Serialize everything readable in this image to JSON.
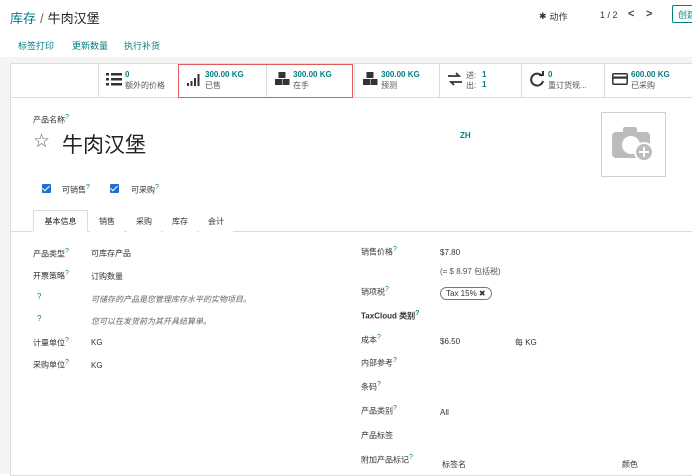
{
  "breadcrumb": {
    "parent": "库存",
    "separator": "/",
    "current": "牛肉汉堡"
  },
  "header": {
    "actions_label": "动作",
    "pager": "1 / 2",
    "create_label": "创建"
  },
  "toolbar": {
    "print_labels": "标签打印",
    "update_qty": "更新数量",
    "replenish": "执行补货"
  },
  "stats": [
    {
      "icon": "list-icon",
      "value": "0",
      "label": "额外的价格"
    },
    {
      "icon": "bar-chart-icon",
      "value": "300.00 KG",
      "label": "已售"
    },
    {
      "icon": "cubes-icon",
      "value": "300.00 KG",
      "label": "在手"
    },
    {
      "icon": "cubes-icon",
      "value": "300.00 KG",
      "label": "预测"
    },
    {
      "icon": "exchange-icon",
      "value": "",
      "label": "",
      "in_label": "进:",
      "in_value": "1",
      "out_label": "出:",
      "out_value": "1"
    },
    {
      "icon": "refresh-icon",
      "value": "0",
      "label": "重订货规..."
    },
    {
      "icon": "credit-card-icon",
      "value": "600.00 KG",
      "label": "已采购"
    }
  ],
  "product": {
    "name_label": "产品名称",
    "name": "牛肉汉堡",
    "lang": "ZH",
    "can_be_sold": "可销售",
    "can_be_purchased": "可采购"
  },
  "tabs": [
    "基本信息",
    "销售",
    "采购",
    "库存",
    "会计"
  ],
  "left_fields": {
    "type_label": "产品类型",
    "type_value": "可库存产品",
    "invoice_label": "开票策略",
    "invoice_value": "订购数量",
    "help1": "可储存的产品是您管理库存水平的实物项目。",
    "help2": "您可以在发货前为其开具结算单。",
    "uom_label": "计量单位",
    "uom_value": "KG",
    "purchase_uom_label": "采购单位",
    "purchase_uom_value": "KG"
  },
  "right_fields": {
    "sale_price_label": "销售价格",
    "sale_price_value": "$7.80",
    "sale_price_incl": "(= $ 8.97 包括税)",
    "tax_label": "销项税",
    "tax_value": "Tax 15%",
    "taxcloud_label": "TaxCloud 类别",
    "cost_label": "成本",
    "cost_value": "$6.50",
    "cost_per": "每 KG",
    "ref_label": "内部参考",
    "barcode_label": "条码",
    "category_label": "产品类别",
    "category_value": "All",
    "tags_label": "产品标签",
    "extra_tags_label": "附加产品标记",
    "col_tag_name": "标签名",
    "col_color": "颜色"
  }
}
